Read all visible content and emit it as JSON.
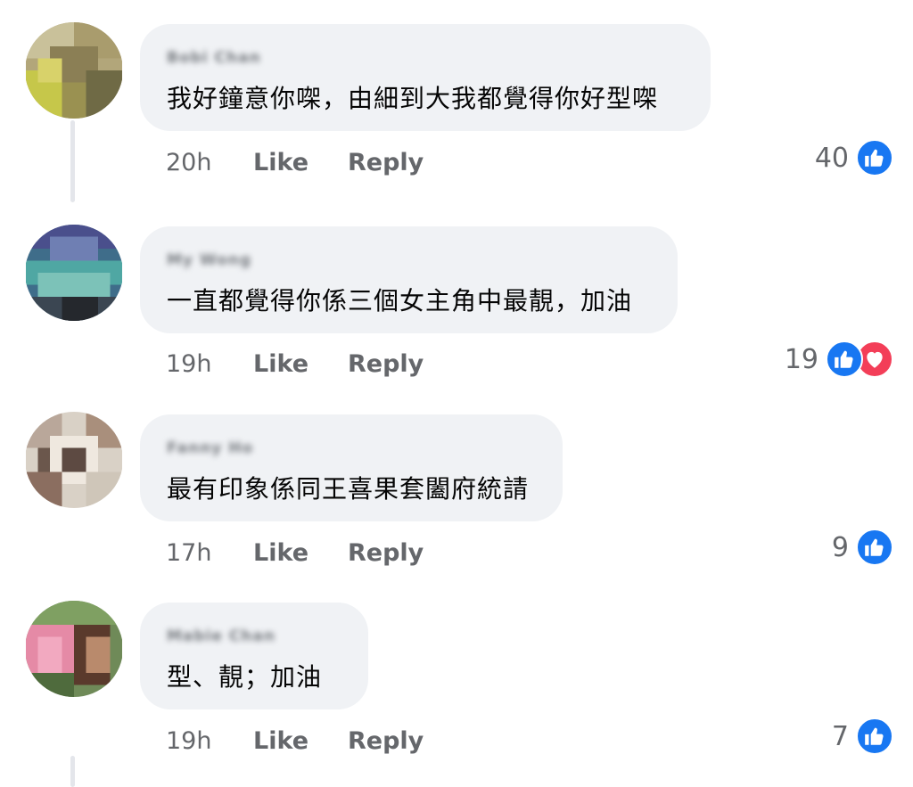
{
  "comments": [
    {
      "author": "Bobi Chan",
      "text": "我好鐘意你㗎，由細到大我都覺得你好型㗎",
      "time": "20h",
      "like_label": "Like",
      "reply_label": "Reply",
      "reaction_count": "40",
      "reactions": [
        "like-icon"
      ]
    },
    {
      "author": "My Wong",
      "text": "一直都覺得你係三個女主角中最靚，加油",
      "time": "19h",
      "like_label": "Like",
      "reply_label": "Reply",
      "reaction_count": "19",
      "reactions": [
        "like-icon",
        "love-icon"
      ]
    },
    {
      "author": "Fanny Ho",
      "text": "最有印象係同王喜果套闔府統請",
      "time": "17h",
      "like_label": "Like",
      "reply_label": "Reply",
      "reaction_count": "9",
      "reactions": [
        "like-icon"
      ]
    },
    {
      "author": "Mabie Chan",
      "text": "型、靚；加油",
      "time": "19h",
      "like_label": "Like",
      "reply_label": "Reply",
      "reaction_count": "7",
      "reactions": [
        "like-icon"
      ]
    }
  ],
  "colors": {
    "like_blue": "#1877f2",
    "love_red": "#f33e58",
    "bubble_bg": "#f0f2f5",
    "meta_gray": "#65676b"
  }
}
